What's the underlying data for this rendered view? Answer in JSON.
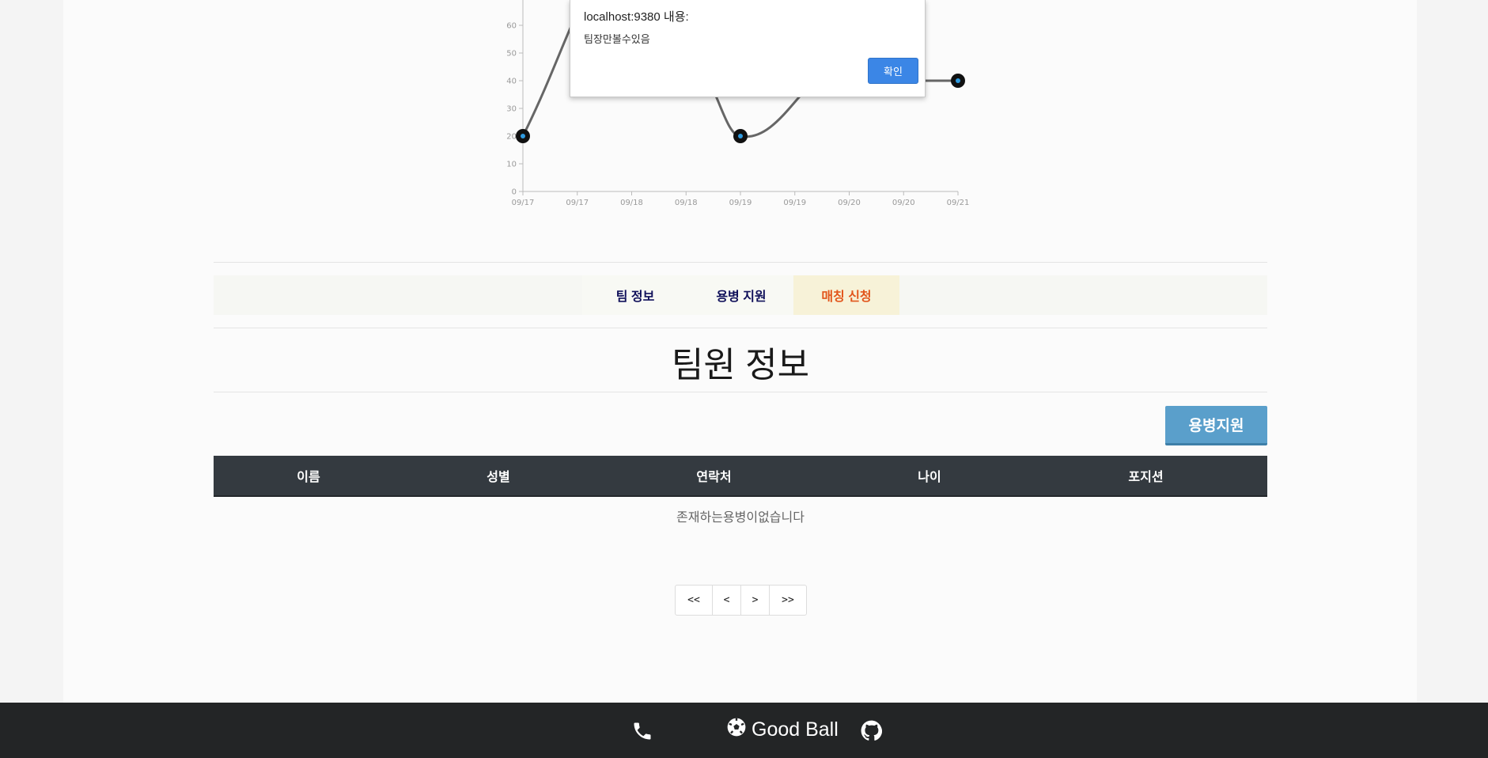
{
  "chart_data": {
    "type": "line",
    "x": [
      "09/17",
      "09/17",
      "09/18",
      "09/18",
      "09/19",
      "09/19",
      "09/20",
      "09/20",
      "09/21"
    ],
    "points": [
      {
        "x": "09/17",
        "y": 20
      },
      {
        "x": "09/19",
        "y": 20
      },
      {
        "x": "09/21",
        "y": 40
      }
    ],
    "y_ticks": [
      0,
      10,
      20,
      30,
      40,
      50,
      60
    ],
    "ylim": [
      0,
      70
    ],
    "line_color": "#666666",
    "point_color": "#111111",
    "point_center_color": "#2f9be0"
  },
  "dialog": {
    "title": "localhost:9380 내용:",
    "message": "팀장만볼수있음",
    "ok_label": "확인"
  },
  "tabs": [
    {
      "label": "팀 정보"
    },
    {
      "label": "용병 지원"
    },
    {
      "label": "매칭 신청"
    }
  ],
  "section_title": "팀원 정보",
  "mercenary_button": "용병지원",
  "table": {
    "columns": [
      "이름",
      "성별",
      "연락처",
      "나이",
      "포지션"
    ],
    "empty_message": "존재하는용병이없습니다"
  },
  "pagination": [
    "<<",
    "<",
    ">",
    ">>"
  ],
  "footer": {
    "brand": "Good Ball",
    "icons": [
      "phone-icon",
      "soccer-ball-icon",
      "github-icon"
    ]
  }
}
